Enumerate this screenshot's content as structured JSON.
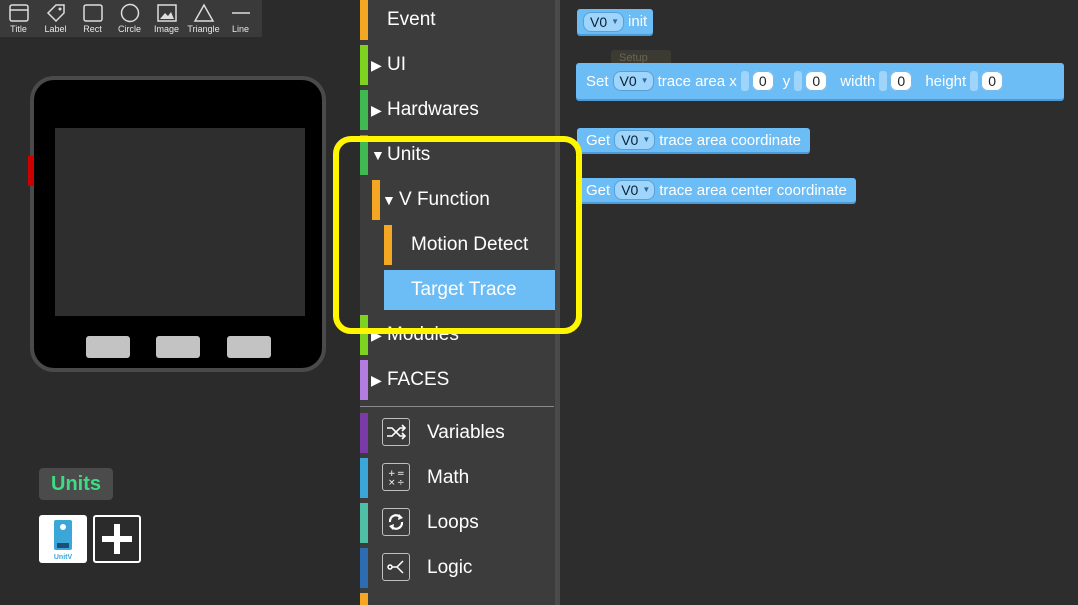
{
  "tools": [
    {
      "label": "Title",
      "icon": "title-icon"
    },
    {
      "label": "Label",
      "icon": "label-icon"
    },
    {
      "label": "Rect",
      "icon": "rect-icon"
    },
    {
      "label": "Circle",
      "icon": "circle-icon"
    },
    {
      "label": "Image",
      "icon": "image-icon"
    },
    {
      "label": "Triangle",
      "icon": "triangle-icon"
    },
    {
      "label": "Line",
      "icon": "line-icon"
    }
  ],
  "units_panel": {
    "title": "Units",
    "unit_badge": "UnitV"
  },
  "categories": [
    {
      "label": "Event",
      "color": "#f5a623"
    },
    {
      "label": "UI",
      "color": "#7ed321"
    },
    {
      "label": "Hardwares",
      "color": "#3fb950"
    },
    {
      "label": "Units",
      "color": "#3fb950"
    },
    {
      "label": "V Function",
      "color": "#f5a623"
    },
    {
      "label": "Motion Detect",
      "color": "#f5a623"
    },
    {
      "label": "Target Trace",
      "color": "#6cbcf5"
    },
    {
      "label": "Modules",
      "color": "#7ed321"
    },
    {
      "label": "FACES",
      "color": "#b27ce0"
    },
    {
      "label": "Variables",
      "color": "#7a3aa8",
      "icon": "shuffle-icon"
    },
    {
      "label": "Math",
      "color": "#3ba6d8",
      "icon": "math-icon"
    },
    {
      "label": "Loops",
      "color": "#4fc0a5",
      "icon": "loop-icon"
    },
    {
      "label": "Logic",
      "color": "#2d6cb0",
      "icon": "logic-icon"
    }
  ],
  "blocks": {
    "init": {
      "var": "V0",
      "text": "init"
    },
    "ghost": {
      "text": "Setup"
    },
    "set_area": {
      "set": "Set",
      "var": "V0",
      "t1": "trace area x",
      "x": "0",
      "y_label": "y",
      "y": "0",
      "w_label": "width",
      "w": "0",
      "h_label": "height",
      "h": "0"
    },
    "get_coord": {
      "get": "Get",
      "var": "V0",
      "text": "trace area coordinate"
    },
    "get_center": {
      "get": "Get",
      "var": "V0",
      "text": "trace area center coordinate"
    }
  },
  "colors": {
    "highlight": "#fff600",
    "block": "#6cbcf5",
    "selected": "#6cbcf5"
  }
}
